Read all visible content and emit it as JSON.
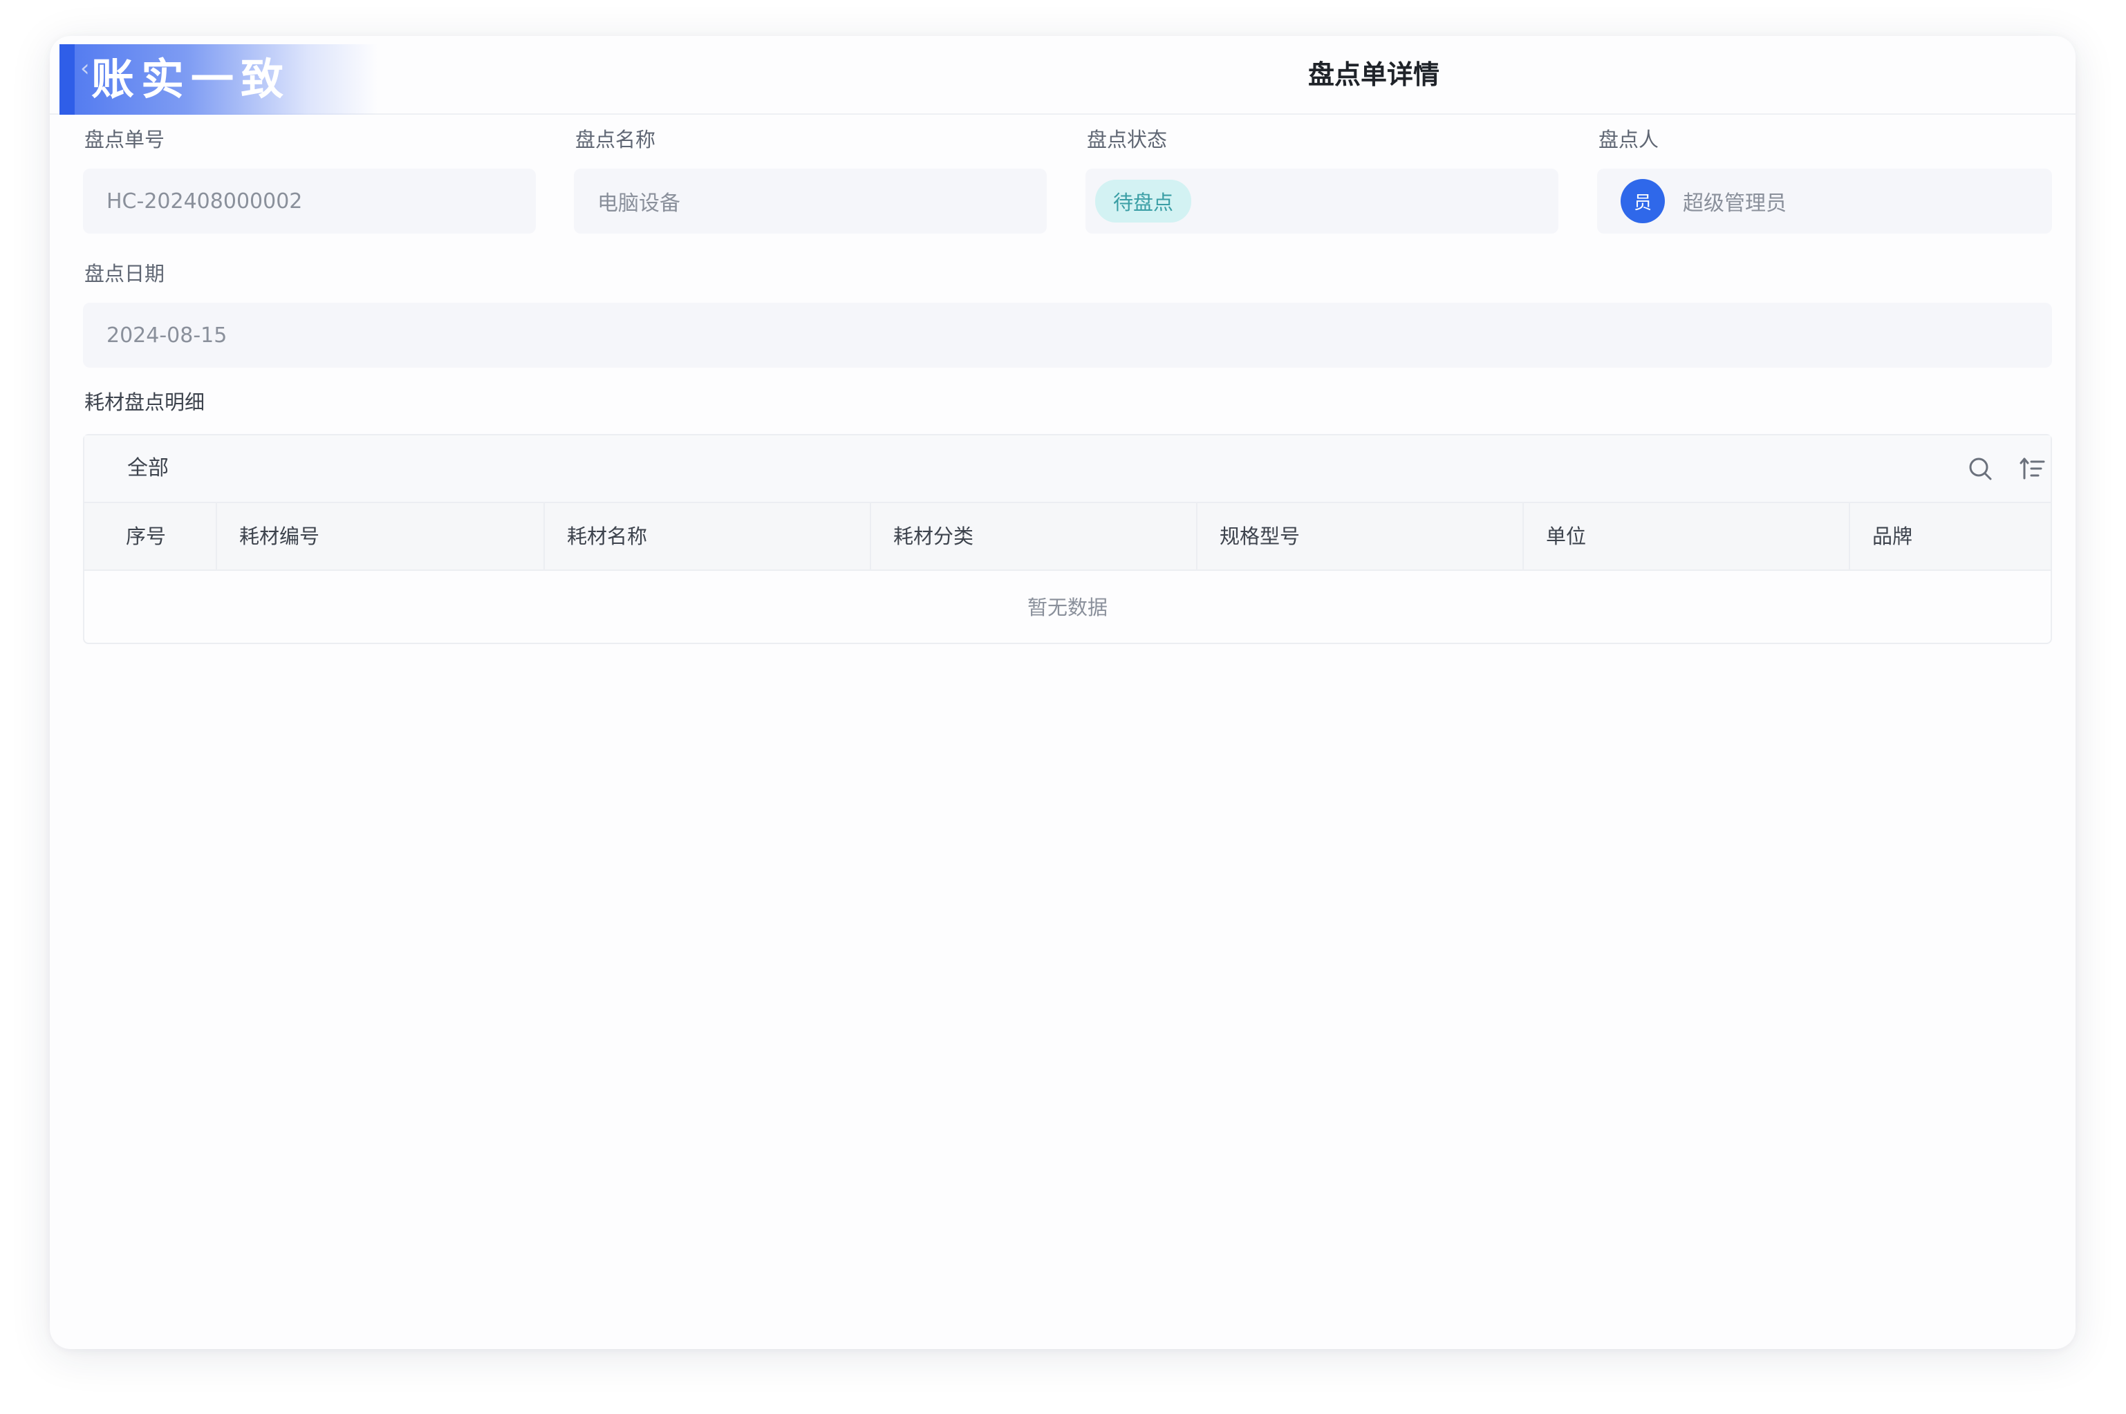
{
  "header": {
    "brand": "账实一致",
    "title": "盘点单详情"
  },
  "fields": {
    "order_no": {
      "label": "盘点单号",
      "value": "HC-202408000002"
    },
    "name": {
      "label": "盘点名称",
      "value": "电脑设备"
    },
    "status": {
      "label": "盘点状态",
      "value": "待盘点"
    },
    "operator": {
      "label": "盘点人",
      "avatar": "员",
      "value": "超级管理员"
    },
    "date": {
      "label": "盘点日期",
      "value": "2024-08-15"
    }
  },
  "detail": {
    "title": "耗材盘点明细",
    "filter_tab": "全部",
    "icons": {
      "search": "search-icon",
      "sort": "sort-icon"
    },
    "columns": [
      "序号",
      "耗材编号",
      "耗材名称",
      "耗材分类",
      "规格型号",
      "单位",
      "品牌"
    ],
    "rows": [],
    "empty_text": "暂无数据"
  },
  "colors": {
    "accent": "#2f68ea",
    "status_bg": "#d3f2f3",
    "status_text": "#3a9ea5"
  }
}
